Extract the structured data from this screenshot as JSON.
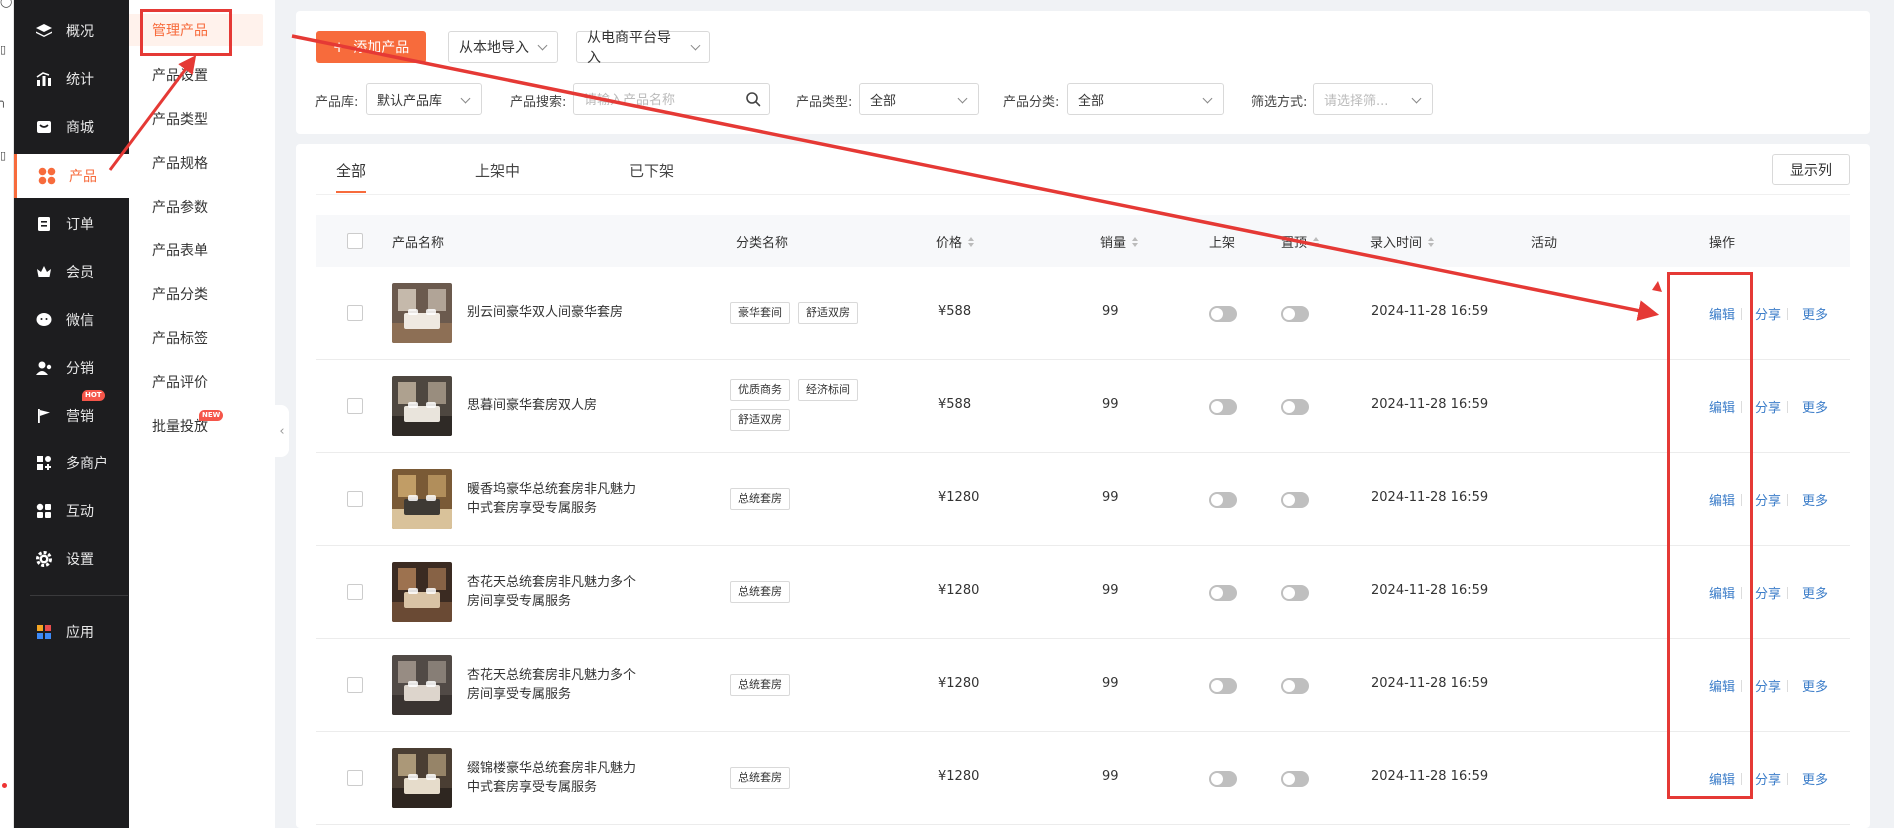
{
  "sidebar": {
    "items": [
      {
        "label": "概况",
        "icon": "layers-icon"
      },
      {
        "label": "统计",
        "icon": "chart-icon"
      },
      {
        "label": "商城",
        "icon": "store-icon"
      },
      {
        "label": "产品",
        "icon": "product-icon",
        "active": true
      },
      {
        "label": "订单",
        "icon": "order-icon"
      },
      {
        "label": "会员",
        "icon": "crown-icon"
      },
      {
        "label": "微信",
        "icon": "wechat-icon"
      },
      {
        "label": "分销",
        "icon": "distribution-icon"
      },
      {
        "label": "营销",
        "icon": "flag-icon",
        "badge": "HOT"
      },
      {
        "label": "多商户",
        "icon": "merchant-icon"
      },
      {
        "label": "互动",
        "icon": "interact-icon"
      },
      {
        "label": "设置",
        "icon": "gear-icon"
      },
      {
        "label": "应用",
        "icon": "apps-icon"
      }
    ]
  },
  "subnav": {
    "items": [
      {
        "label": "管理产品",
        "active": true
      },
      {
        "label": "产品设置"
      },
      {
        "label": "产品类型"
      },
      {
        "label": "产品规格"
      },
      {
        "label": "产品参数"
      },
      {
        "label": "产品表单"
      },
      {
        "label": "产品分类"
      },
      {
        "label": "产品标签"
      },
      {
        "label": "产品评价"
      },
      {
        "label": "批量投放",
        "badge": "NEW"
      }
    ]
  },
  "toolbar": {
    "add_label": "添加产品",
    "import_local_label": "从本地导入",
    "import_ecommerce_label": "从电商平台导入"
  },
  "filters": {
    "library_label": "产品库:",
    "library_value": "默认产品库",
    "search_label": "产品搜索:",
    "search_placeholder": "请输入产品名称",
    "type_label": "产品类型:",
    "type_value": "全部",
    "category_label": "产品分类:",
    "category_value": "全部",
    "filter_label": "筛选方式:",
    "filter_placeholder": "请选择筛..."
  },
  "tabs": [
    {
      "label": "全部",
      "active": true
    },
    {
      "label": "上架中"
    },
    {
      "label": "已下架"
    }
  ],
  "columns_button": "显示列",
  "table": {
    "headers": {
      "name": "产品名称",
      "category": "分类名称",
      "price": "价格",
      "sales": "销量",
      "listed": "上架",
      "pinned": "置顶",
      "time": "录入时间",
      "activity": "活动",
      "actions": "操作"
    },
    "rows": [
      {
        "name": "别云间豪华双人间豪华套房",
        "tags": [
          "豪华套间",
          "舒适双房"
        ],
        "price": "¥588",
        "sales": "99",
        "time": "2024-11-28 16:59",
        "listed": false,
        "pinned": false
      },
      {
        "name": "思暮间豪华套房双人房",
        "tags": [
          "优质商务",
          "经济标间",
          "舒适双房"
        ],
        "price": "¥588",
        "sales": "99",
        "time": "2024-11-28 16:59",
        "listed": false,
        "pinned": false
      },
      {
        "name": "暖香坞豪华总统套房非凡魅力中式套房享受专属服务",
        "tags": [
          "总统套房"
        ],
        "price": "¥1280",
        "sales": "99",
        "time": "2024-11-28 16:59",
        "listed": false,
        "pinned": false
      },
      {
        "name": "杏花天总统套房非凡魅力多个房间享受专属服务",
        "tags": [
          "总统套房"
        ],
        "price": "¥1280",
        "sales": "99",
        "time": "2024-11-28 16:59",
        "listed": false,
        "pinned": false
      },
      {
        "name": "杏花天总统套房非凡魅力多个房间享受专属服务",
        "tags": [
          "总统套房"
        ],
        "price": "¥1280",
        "sales": "99",
        "time": "2024-11-28 16:59",
        "listed": false,
        "pinned": false
      },
      {
        "name": "缀锦楼豪华总统套房非凡魅力中式套房享受专属服务",
        "tags": [
          "总统套房"
        ],
        "price": "¥1280",
        "sales": "99",
        "time": "2024-11-28 16:59",
        "listed": false,
        "pinned": false
      }
    ],
    "actions": {
      "edit": "编辑",
      "share": "分享",
      "more": "更多"
    }
  },
  "colors": {
    "accent": "#f76b3c",
    "sidebar_bg": "#1d1d1f",
    "link": "#3d7ec9",
    "annotation": "#e53935",
    "hot_badge": "#f5564a"
  }
}
